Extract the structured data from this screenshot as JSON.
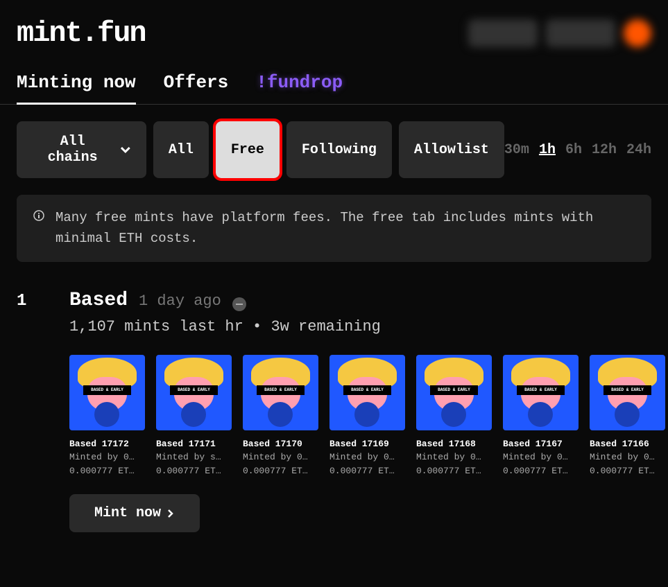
{
  "logo": "mint.fun",
  "tabs": [
    {
      "label": "Minting now",
      "active": true
    },
    {
      "label": "Offers",
      "active": false
    },
    {
      "label": "!fundrop",
      "active": false,
      "fundrop": true
    }
  ],
  "chain_selector": "All chains",
  "filters": [
    {
      "label": "All",
      "active": false
    },
    {
      "label": "Free",
      "active": true,
      "highlighted": true
    },
    {
      "label": "Following",
      "active": false
    },
    {
      "label": "Allowlist",
      "active": false
    }
  ],
  "time_filters": [
    {
      "label": "30m",
      "active": false
    },
    {
      "label": "1h",
      "active": true
    },
    {
      "label": "6h",
      "active": false
    },
    {
      "label": "12h",
      "active": false
    },
    {
      "label": "24h",
      "active": false
    }
  ],
  "info_banner": "Many free mints have platform fees. The free tab includes mints with minimal ETH costs.",
  "listing": {
    "rank": "1",
    "title": "Based",
    "time": "1 day ago",
    "stats": "1,107 mints last hr • 3w remaining",
    "mint_button": "Mint now",
    "nft_bar_text": "BASED & EARLY"
  },
  "nfts": [
    {
      "name": "Based 17172",
      "minter": "Minted by 0…",
      "price": "0.000777 ET…"
    },
    {
      "name": "Based 17171",
      "minter": "Minted by s…",
      "price": "0.000777 ET…"
    },
    {
      "name": "Based 17170",
      "minter": "Minted by 0…",
      "price": "0.000777 ET…"
    },
    {
      "name": "Based 17169",
      "minter": "Minted by 0…",
      "price": "0.000777 ET…"
    },
    {
      "name": "Based 17168",
      "minter": "Minted by 0…",
      "price": "0.000777 ET…"
    },
    {
      "name": "Based 17167",
      "minter": "Minted by 0…",
      "price": "0.000777 ET…"
    },
    {
      "name": "Based 17166",
      "minter": "Minted by 0…",
      "price": "0.000777 ET…"
    }
  ]
}
